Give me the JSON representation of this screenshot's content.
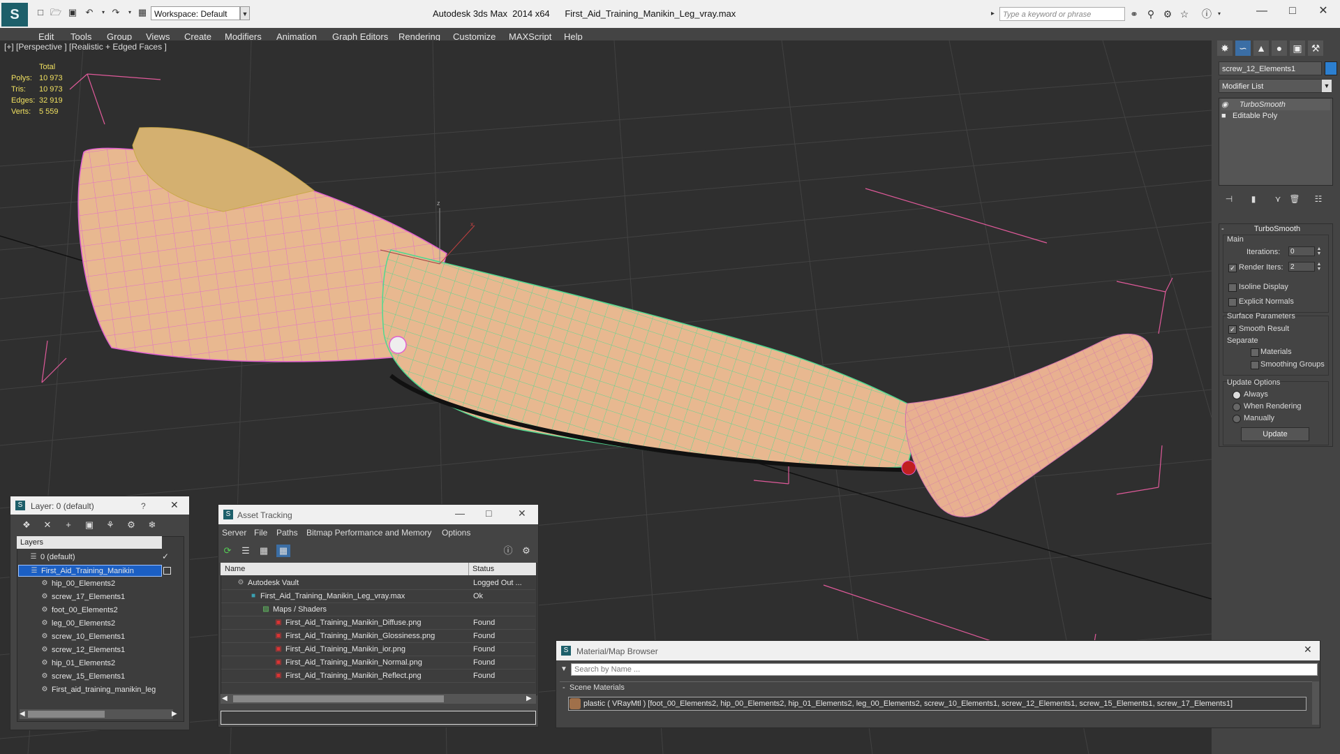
{
  "titlebar": {
    "workspace": "Workspace: Default",
    "title": "Autodesk 3ds Max  2014 x64      First_Aid_Training_Manikin_Leg_vray.max",
    "search_placeholder": "Type a keyword or phrase"
  },
  "menu": [
    "Edit",
    "Tools",
    "Group",
    "Views",
    "Create",
    "Modifiers",
    "Animation",
    "Graph Editors",
    "Rendering",
    "Customize",
    "MAXScript",
    "Help"
  ],
  "viewport": {
    "label": "[+] [Perspective ] [Realistic + Edged Faces ]",
    "stats": {
      "header": "Total",
      "rows": [
        {
          "label": "Polys:",
          "value": "10 973"
        },
        {
          "label": "Tris:",
          "value": "10 973"
        },
        {
          "label": "Edges:",
          "value": "32 919"
        },
        {
          "label": "Verts:",
          "value": "5 559"
        }
      ]
    },
    "gizmo_x": "x",
    "gizmo_z": "z",
    "colors": {
      "background": "#2f2f2f",
      "grid": "#444444",
      "selection_wire": "#e060d0",
      "selected_wire": "#50e090",
      "skin": "#e8b890",
      "bbox": "#e05a9a"
    }
  },
  "command_panel": {
    "object_name": "screw_12_Elements1",
    "object_color": "#2c7fd0",
    "modifier_list": "Modifier List",
    "stack": [
      "TurboSmooth",
      "Editable Poly"
    ],
    "turbosmooth": {
      "title": "TurboSmooth",
      "main": "Main",
      "iterations_label": "Iterations:",
      "iterations": "0",
      "render_iters_label": "Render Iters:",
      "render_iters": "2",
      "isoline": "Isoline Display",
      "explicit_normals": "Explicit Normals",
      "surface_params": "Surface Parameters",
      "smooth_result": "Smooth Result",
      "separate": "Separate",
      "materials": "Materials",
      "smoothing_groups": "Smoothing Groups",
      "update_options": "Update Options",
      "always": "Always",
      "when_rendering": "When Rendering",
      "manually": "Manually",
      "update": "Update"
    }
  },
  "layer_panel": {
    "title": "Layer: 0 (default)",
    "help": "?",
    "header": "Layers",
    "items": [
      {
        "label": "0 (default)",
        "level": 0,
        "selected": false
      },
      {
        "label": "First_Aid_Training_Manikin",
        "level": 0,
        "selected": true
      },
      {
        "label": "hip_00_Elements2",
        "level": 1,
        "selected": false
      },
      {
        "label": "screw_17_Elements1",
        "level": 1,
        "selected": false
      },
      {
        "label": "foot_00_Elements2",
        "level": 1,
        "selected": false
      },
      {
        "label": "leg_00_Elements2",
        "level": 1,
        "selected": false
      },
      {
        "label": "screw_10_Elements1",
        "level": 1,
        "selected": false
      },
      {
        "label": "screw_12_Elements1",
        "level": 1,
        "selected": false
      },
      {
        "label": "hip_01_Elements2",
        "level": 1,
        "selected": false
      },
      {
        "label": "screw_15_Elements1",
        "level": 1,
        "selected": false
      },
      {
        "label": "First_aid_training_manikin_leg",
        "level": 1,
        "selected": false
      }
    ]
  },
  "asset_tracking": {
    "title": "Asset Tracking",
    "menu": [
      "Server",
      "File",
      "Paths",
      "Bitmap Performance and Memory",
      "Options"
    ],
    "columns": [
      "Name",
      "Status"
    ],
    "rows": [
      {
        "name": "Autodesk Vault",
        "status": "Logged Out ...",
        "level": 1,
        "icon": "vault-icon"
      },
      {
        "name": "First_Aid_Training_Manikin_Leg_vray.max",
        "status": "Ok",
        "level": 2,
        "icon": "max-file-icon"
      },
      {
        "name": "Maps / Shaders",
        "status": "",
        "level": 3,
        "icon": "maps-icon"
      },
      {
        "name": "First_Aid_Training_Manikin_Diffuse.png",
        "status": "Found",
        "level": 4,
        "icon": "png-icon"
      },
      {
        "name": "First_Aid_Training_Manikin_Glossiness.png",
        "status": "Found",
        "level": 4,
        "icon": "png-icon"
      },
      {
        "name": "First_Aid_Training_Manikin_ior.png",
        "status": "Found",
        "level": 4,
        "icon": "png-icon"
      },
      {
        "name": "First_Aid_Training_Manikin_Normal.png",
        "status": "Found",
        "level": 4,
        "icon": "png-icon"
      },
      {
        "name": "First_Aid_Training_Manikin_Reflect.png",
        "status": "Found",
        "level": 4,
        "icon": "png-icon"
      }
    ]
  },
  "material_browser": {
    "title": "Material/Map Browser",
    "search_placeholder": "Search by Name ...",
    "section": "Scene Materials",
    "material": "plastic  ( VRayMtl )  [foot_00_Elements2, hip_00_Elements2, hip_01_Elements2, leg_00_Elements2, screw_10_Elements1, screw_12_Elements1, screw_15_Elements1, screw_17_Elements1]"
  }
}
